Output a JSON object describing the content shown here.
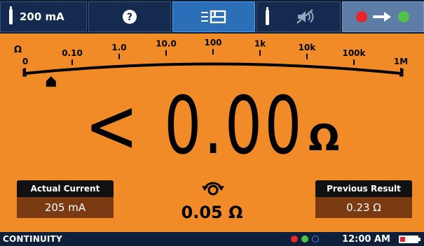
{
  "toolbar": {
    "test_current": "200 mA",
    "help_icon": "help-circle-icon",
    "log_icon": "save-log-icon",
    "sound_icon": "sound-muted-icon",
    "status": {
      "from_color": "#e8262a",
      "to_color": "#4fc24a"
    }
  },
  "scale": {
    "unit_label": "Ω",
    "ticks": [
      {
        "label": "0"
      },
      {
        "label": "0.10"
      },
      {
        "label": "1.0"
      },
      {
        "label": "10.0"
      },
      {
        "label": "100"
      },
      {
        "label": "1k"
      },
      {
        "label": "10k"
      },
      {
        "label": "100k"
      },
      {
        "label": "1M"
      }
    ],
    "pointer_tick": 0.55
  },
  "reading": {
    "prefix": "<",
    "value": "0.00",
    "unit": "Ω"
  },
  "actual_current": {
    "title": "Actual Current",
    "value": "205 mA"
  },
  "previous_result": {
    "title": "Previous Result",
    "value": "0.23 Ω"
  },
  "lead_null": {
    "value": "0.05 Ω"
  },
  "statusbar": {
    "mode": "CONTINUITY",
    "indicators": [
      "#e8262a",
      "#4fc24a",
      "#3d86d6"
    ],
    "time": "12:00 AM",
    "battery_level": 0.3
  },
  "colors": {
    "panel": "#f08b28",
    "toolbar": "#142a4f",
    "active": "#2a6fb7"
  }
}
